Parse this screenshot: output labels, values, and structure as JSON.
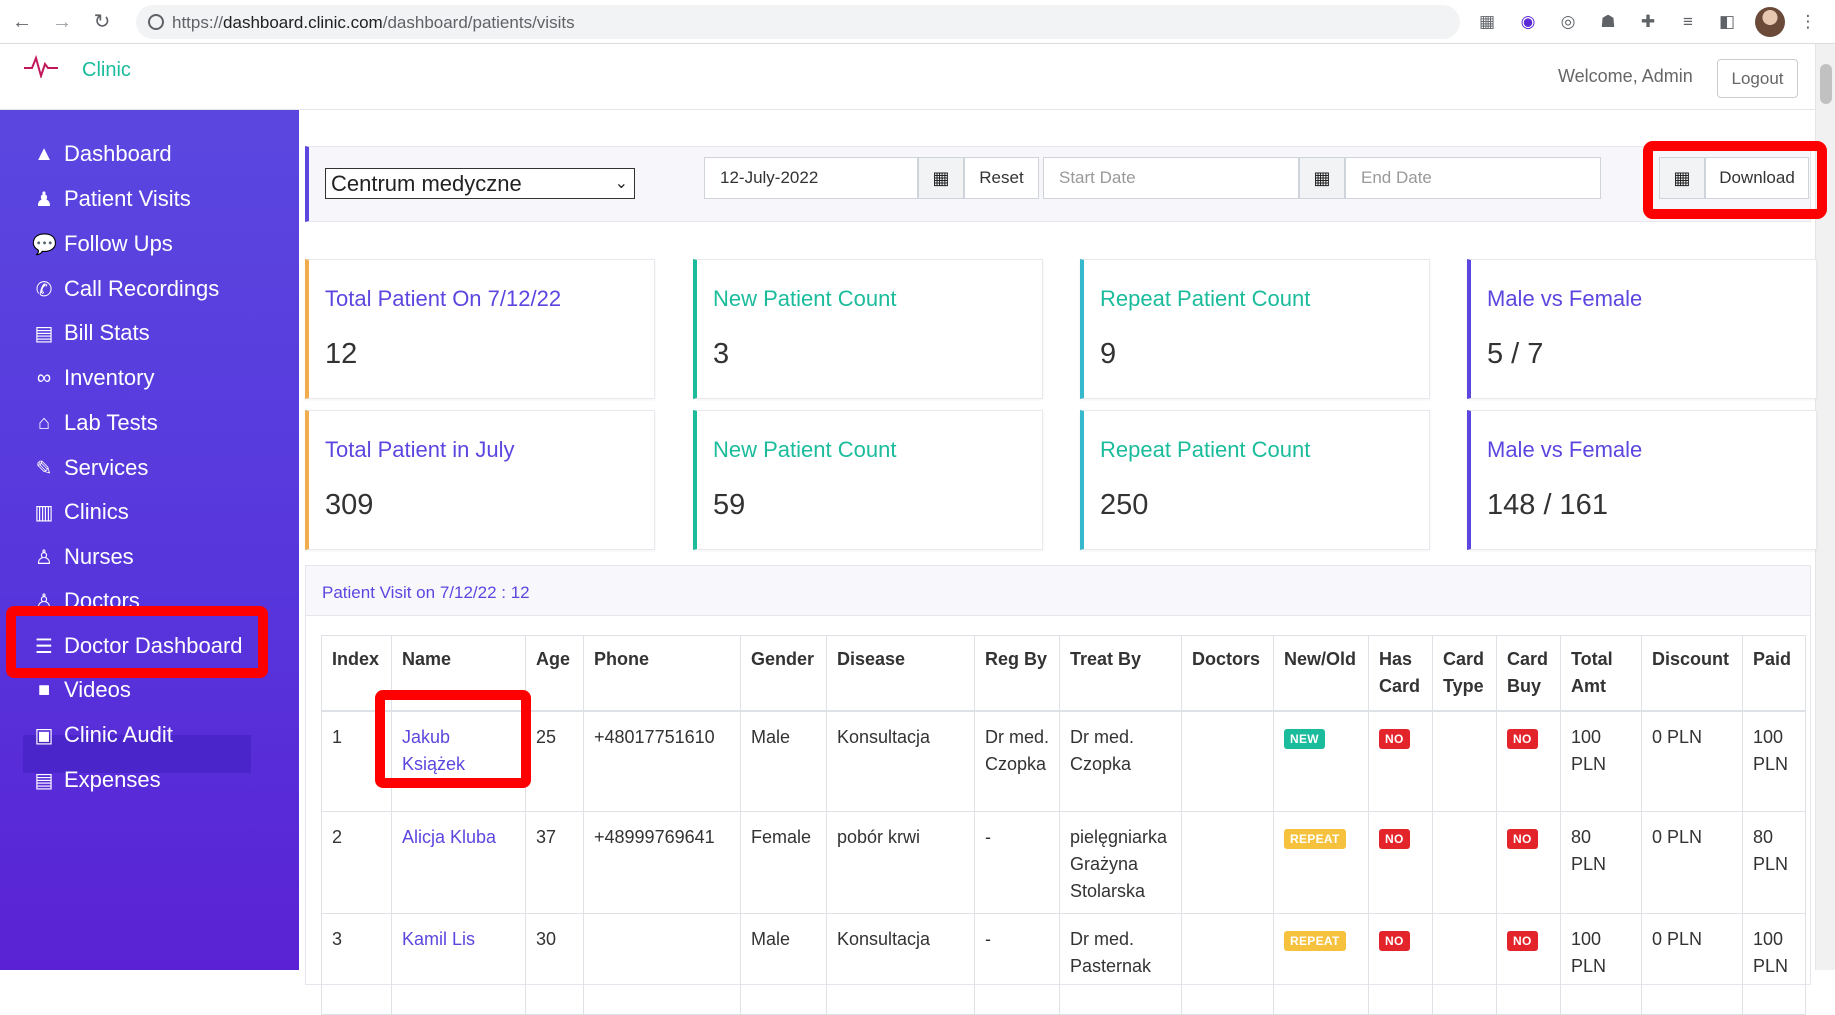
{
  "browser": {
    "url_prefix": "https://",
    "url_host": "dashboard.clinic.com",
    "url_path": "/dashboard/patients/visits"
  },
  "header": {
    "brand": "Clinic",
    "welcome": "Welcome, Admin",
    "logout_label": "Logout"
  },
  "sidebar": {
    "items": [
      {
        "label": "Dashboard",
        "icon": "chart-area-icon"
      },
      {
        "label": "Patient Visits",
        "icon": "user-injured-icon"
      },
      {
        "label": "Follow Ups",
        "icon": "comments-icon"
      },
      {
        "label": "Call Recordings",
        "icon": "phone-icon"
      },
      {
        "label": "Bill Stats",
        "icon": "invoice-dollar-icon"
      },
      {
        "label": "Inventory",
        "icon": "pills-icon"
      },
      {
        "label": "Lab Tests",
        "icon": "clinic-house-icon"
      },
      {
        "label": "Services",
        "icon": "syringe-icon"
      },
      {
        "label": "Clinics",
        "icon": "hospital-icon"
      },
      {
        "label": "Nurses",
        "icon": "user-nurse-icon"
      },
      {
        "label": "Doctors",
        "icon": "user-md-icon"
      },
      {
        "label": "Doctor Dashboard",
        "icon": "list-check-icon"
      },
      {
        "label": "Videos",
        "icon": "video-icon"
      },
      {
        "label": "Clinic Audit",
        "icon": "clipboard-list-icon"
      },
      {
        "label": "Expenses",
        "icon": "file-invoice-dollar-icon"
      }
    ]
  },
  "filters": {
    "clinic_selected": "Centrum medyczne",
    "date_value": "12-July-2022",
    "reset_label": "Reset",
    "start_placeholder": "Start Date",
    "end_placeholder": "End Date",
    "download_label": "Download"
  },
  "cards": [
    {
      "title": "Total Patient On 7/12/22",
      "value": "12",
      "color": "#5b47e0",
      "border": "#f0ad4e"
    },
    {
      "title": "New Patient Count",
      "value": "3",
      "color": "#1abc9c",
      "border": "#1abc9c"
    },
    {
      "title": "Repeat Patient Count",
      "value": "9",
      "color": "#1abc9c",
      "border": "#36b9cc"
    },
    {
      "title": "Male vs Female",
      "value": "5 / 7",
      "color": "#5b47e0",
      "border": "#5b47e0"
    },
    {
      "title": "Total Patient in July",
      "value": "309",
      "color": "#5b47e0",
      "border": "#f0ad4e"
    },
    {
      "title": "New Patient Count",
      "value": "59",
      "color": "#1abc9c",
      "border": "#1abc9c"
    },
    {
      "title": "Repeat Patient Count",
      "value": "250",
      "color": "#1abc9c",
      "border": "#36b9cc"
    },
    {
      "title": "Male vs Female",
      "value": "148 / 161",
      "color": "#5b47e0",
      "border": "#5b47e0"
    }
  ],
  "visits": {
    "title": "Patient Visit on 7/12/22 : 12",
    "columns": [
      "Index",
      "Name",
      "Age",
      "Phone",
      "Gender",
      "Disease",
      "Reg By",
      "Treat By",
      "Doctors",
      "New/Old",
      "Has Card",
      "Card Type",
      "Card Buy",
      "Total Amt",
      "Discount",
      "Paid"
    ],
    "rows": [
      {
        "index": "1",
        "name": "Jakub Książek",
        "age": "25",
        "phone": "+48017751610",
        "gender": "Male",
        "disease": "Konsultacja",
        "reg_by": "Dr med. Czopka",
        "treat_by": "Dr med. Czopka",
        "doctors": "",
        "new_old": "NEW",
        "has_card": "NO",
        "card_type": "",
        "card_buy": "NO",
        "total": "100 PLN",
        "discount": "0 PLN",
        "paid": "100 PLN"
      },
      {
        "index": "2",
        "name": "Alicja Kluba",
        "age": "37",
        "phone": "+48999769641",
        "gender": "Female",
        "disease": "pobór krwi",
        "reg_by": "-",
        "treat_by": "pielęgniarka Grażyna Stolarska",
        "doctors": "",
        "new_old": "REPEAT",
        "has_card": "NO",
        "card_type": "",
        "card_buy": "NO",
        "total": "80 PLN",
        "discount": "0 PLN",
        "paid": "80 PLN"
      },
      {
        "index": "3",
        "name": "Kamil Lis",
        "age": "30",
        "phone": "",
        "gender": "Male",
        "disease": "Konsultacja",
        "reg_by": "-",
        "treat_by": "Dr med. Pasternak",
        "doctors": "",
        "new_old": "REPEAT",
        "has_card": "NO",
        "card_type": "",
        "card_buy": "NO",
        "total": "100 PLN",
        "discount": "0 PLN",
        "paid": "100 PLN"
      }
    ]
  }
}
